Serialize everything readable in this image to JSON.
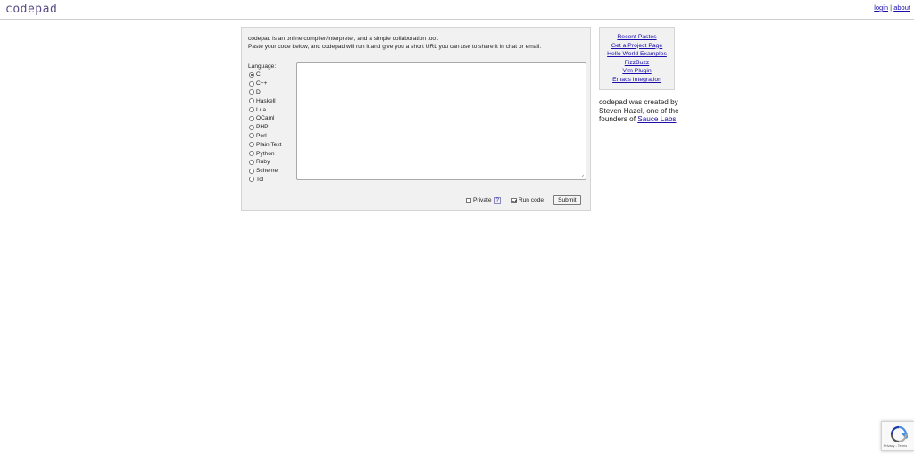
{
  "header": {
    "logo": "codepad",
    "login_label": "login",
    "separator": "|",
    "about_label": "about"
  },
  "intro": {
    "line1": "codepad is an online compiler/interpreter, and a simple collaboration tool.",
    "line2": "Paste your code below, and codepad will run it and give you a short URL you can use to share it in chat or email."
  },
  "language": {
    "label": "Language:",
    "selected": "C",
    "options": [
      "C",
      "C++",
      "D",
      "Haskell",
      "Lua",
      "OCaml",
      "PHP",
      "Perl",
      "Plain Text",
      "Python",
      "Ruby",
      "Scheme",
      "Tcl"
    ]
  },
  "editor": {
    "value": ""
  },
  "options": {
    "private_label": "Private",
    "private_checked": false,
    "help_label": "?",
    "run_code_label": "Run code",
    "run_code_checked": true,
    "submit_label": "Submit"
  },
  "sidebar": {
    "links": [
      "Recent Pastes",
      "Get a Project Page",
      "Hello World Examples",
      "FizzBuzz",
      "Vim Plugin",
      "Emacs Integration"
    ]
  },
  "credit": {
    "text": "codepad was created by Steven Hazel, one of the founders of",
    "link_label": "Sauce Labs",
    "suffix": "."
  },
  "recaptcha": {
    "terms_text": "Privacy - Terms"
  },
  "colors": {
    "logo": "#5a4a86",
    "link": "#1a0dab",
    "panel_bg": "#f1f1f1"
  }
}
